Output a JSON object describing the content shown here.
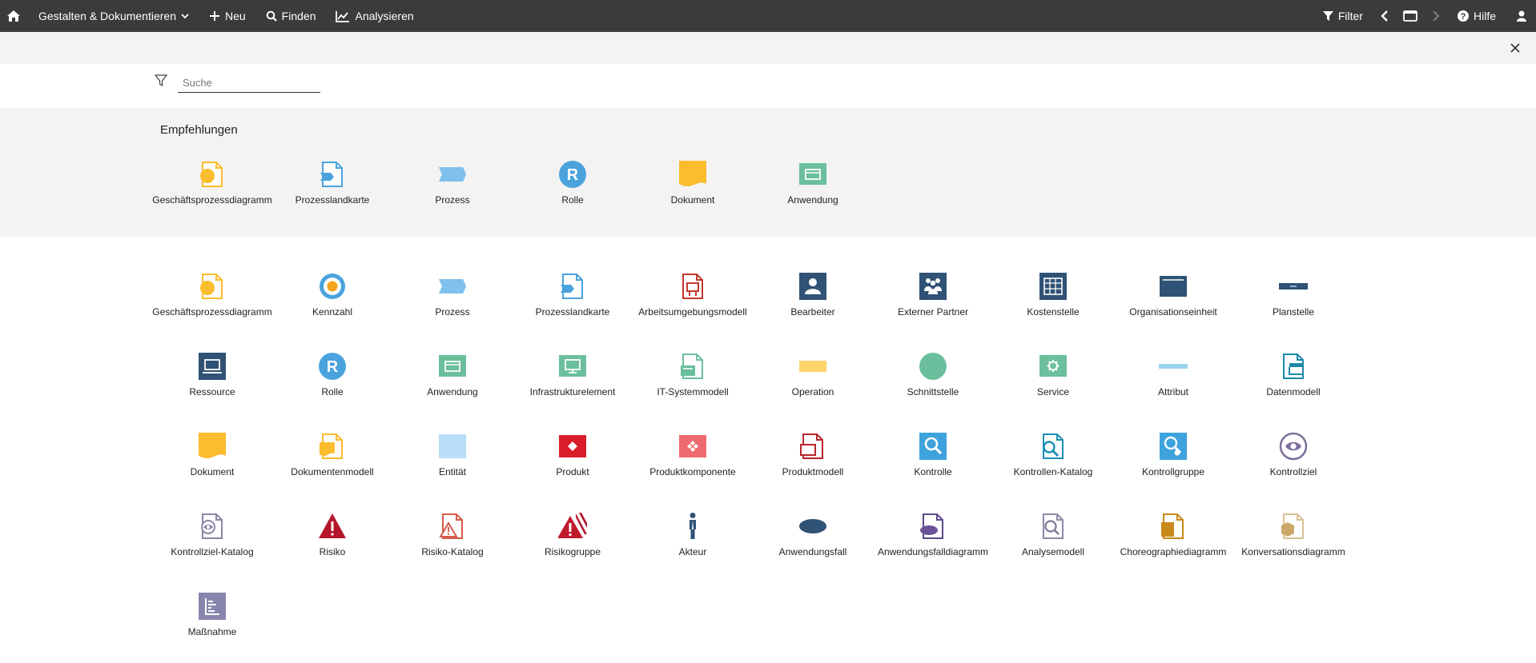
{
  "topbar": {
    "home_icon": "home-icon",
    "menu_gestalten": "Gestalten & Dokumentieren",
    "menu_neu": "Neu",
    "menu_finden": "Finden",
    "menu_analysieren": "Analysieren",
    "filter": "Filter",
    "hilfe": "Hilfe"
  },
  "search": {
    "placeholder": "Suche"
  },
  "recommendations": {
    "title": "Empfehlungen",
    "items": [
      {
        "label": "Geschäftsprozessdiagramm",
        "icon": "bpd"
      },
      {
        "label": "Prozesslandkarte",
        "icon": "plk"
      },
      {
        "label": "Prozess",
        "icon": "prozess"
      },
      {
        "label": "Rolle",
        "icon": "rolle"
      },
      {
        "label": "Dokument",
        "icon": "dokument"
      },
      {
        "label": "Anwendung",
        "icon": "anwendung"
      }
    ]
  },
  "grid": [
    {
      "label": "Geschäftsprozessdiagramm",
      "icon": "bpd"
    },
    {
      "label": "Kennzahl",
      "icon": "kennzahl"
    },
    {
      "label": "Prozess",
      "icon": "prozess"
    },
    {
      "label": "Prozesslandkarte",
      "icon": "plk"
    },
    {
      "label": "Arbeitsumgebungsmodell",
      "icon": "arbeitsumgebung"
    },
    {
      "label": "Bearbeiter",
      "icon": "bearbeiter"
    },
    {
      "label": "Externer Partner",
      "icon": "externer"
    },
    {
      "label": "Kostenstelle",
      "icon": "kostenstelle"
    },
    {
      "label": "Organisationseinheit",
      "icon": "orgeinheit"
    },
    {
      "label": "Planstelle",
      "icon": "planstelle"
    },
    {
      "label": "Ressource",
      "icon": "ressource"
    },
    {
      "label": "Rolle",
      "icon": "rolle"
    },
    {
      "label": "Anwendung",
      "icon": "anwendung"
    },
    {
      "label": "Infrastrukturelement",
      "icon": "infra"
    },
    {
      "label": "IT-Systemmodell",
      "icon": "itsys"
    },
    {
      "label": "Operation",
      "icon": "operation"
    },
    {
      "label": "Schnittstelle",
      "icon": "schnittstelle"
    },
    {
      "label": "Service",
      "icon": "service"
    },
    {
      "label": "Attribut",
      "icon": "attribut"
    },
    {
      "label": "Datenmodell",
      "icon": "datenmodell"
    },
    {
      "label": "Dokument",
      "icon": "dokument"
    },
    {
      "label": "Dokumentenmodell",
      "icon": "dokmodell"
    },
    {
      "label": "Entität",
      "icon": "entitaet"
    },
    {
      "label": "Produkt",
      "icon": "produkt"
    },
    {
      "label": "Produktkomponente",
      "icon": "produktkomp"
    },
    {
      "label": "Produktmodell",
      "icon": "produktmodell"
    },
    {
      "label": "Kontrolle",
      "icon": "kontrolle"
    },
    {
      "label": "Kontrollen-Katalog",
      "icon": "kontrollkatalog"
    },
    {
      "label": "Kontrollgruppe",
      "icon": "kontrollgruppe"
    },
    {
      "label": "Kontrollziel",
      "icon": "kontrollziel"
    },
    {
      "label": "Kontrollziel-Katalog",
      "icon": "kontrollzielkatalog"
    },
    {
      "label": "Risiko",
      "icon": "risiko"
    },
    {
      "label": "Risiko-Katalog",
      "icon": "risikokatalog"
    },
    {
      "label": "Risikogruppe",
      "icon": "risikogruppe"
    },
    {
      "label": "Akteur",
      "icon": "akteur"
    },
    {
      "label": "Anwendungsfall",
      "icon": "anwendungsfall"
    },
    {
      "label": "Anwendungsfalldiagramm",
      "icon": "afdiagramm"
    },
    {
      "label": "Analysemodell",
      "icon": "analysemodell"
    },
    {
      "label": "Choreographiediagramm",
      "icon": "choreo"
    },
    {
      "label": "Konversationsdiagramm",
      "icon": "konversation"
    },
    {
      "label": "Maßnahme",
      "icon": "massnahme"
    }
  ]
}
